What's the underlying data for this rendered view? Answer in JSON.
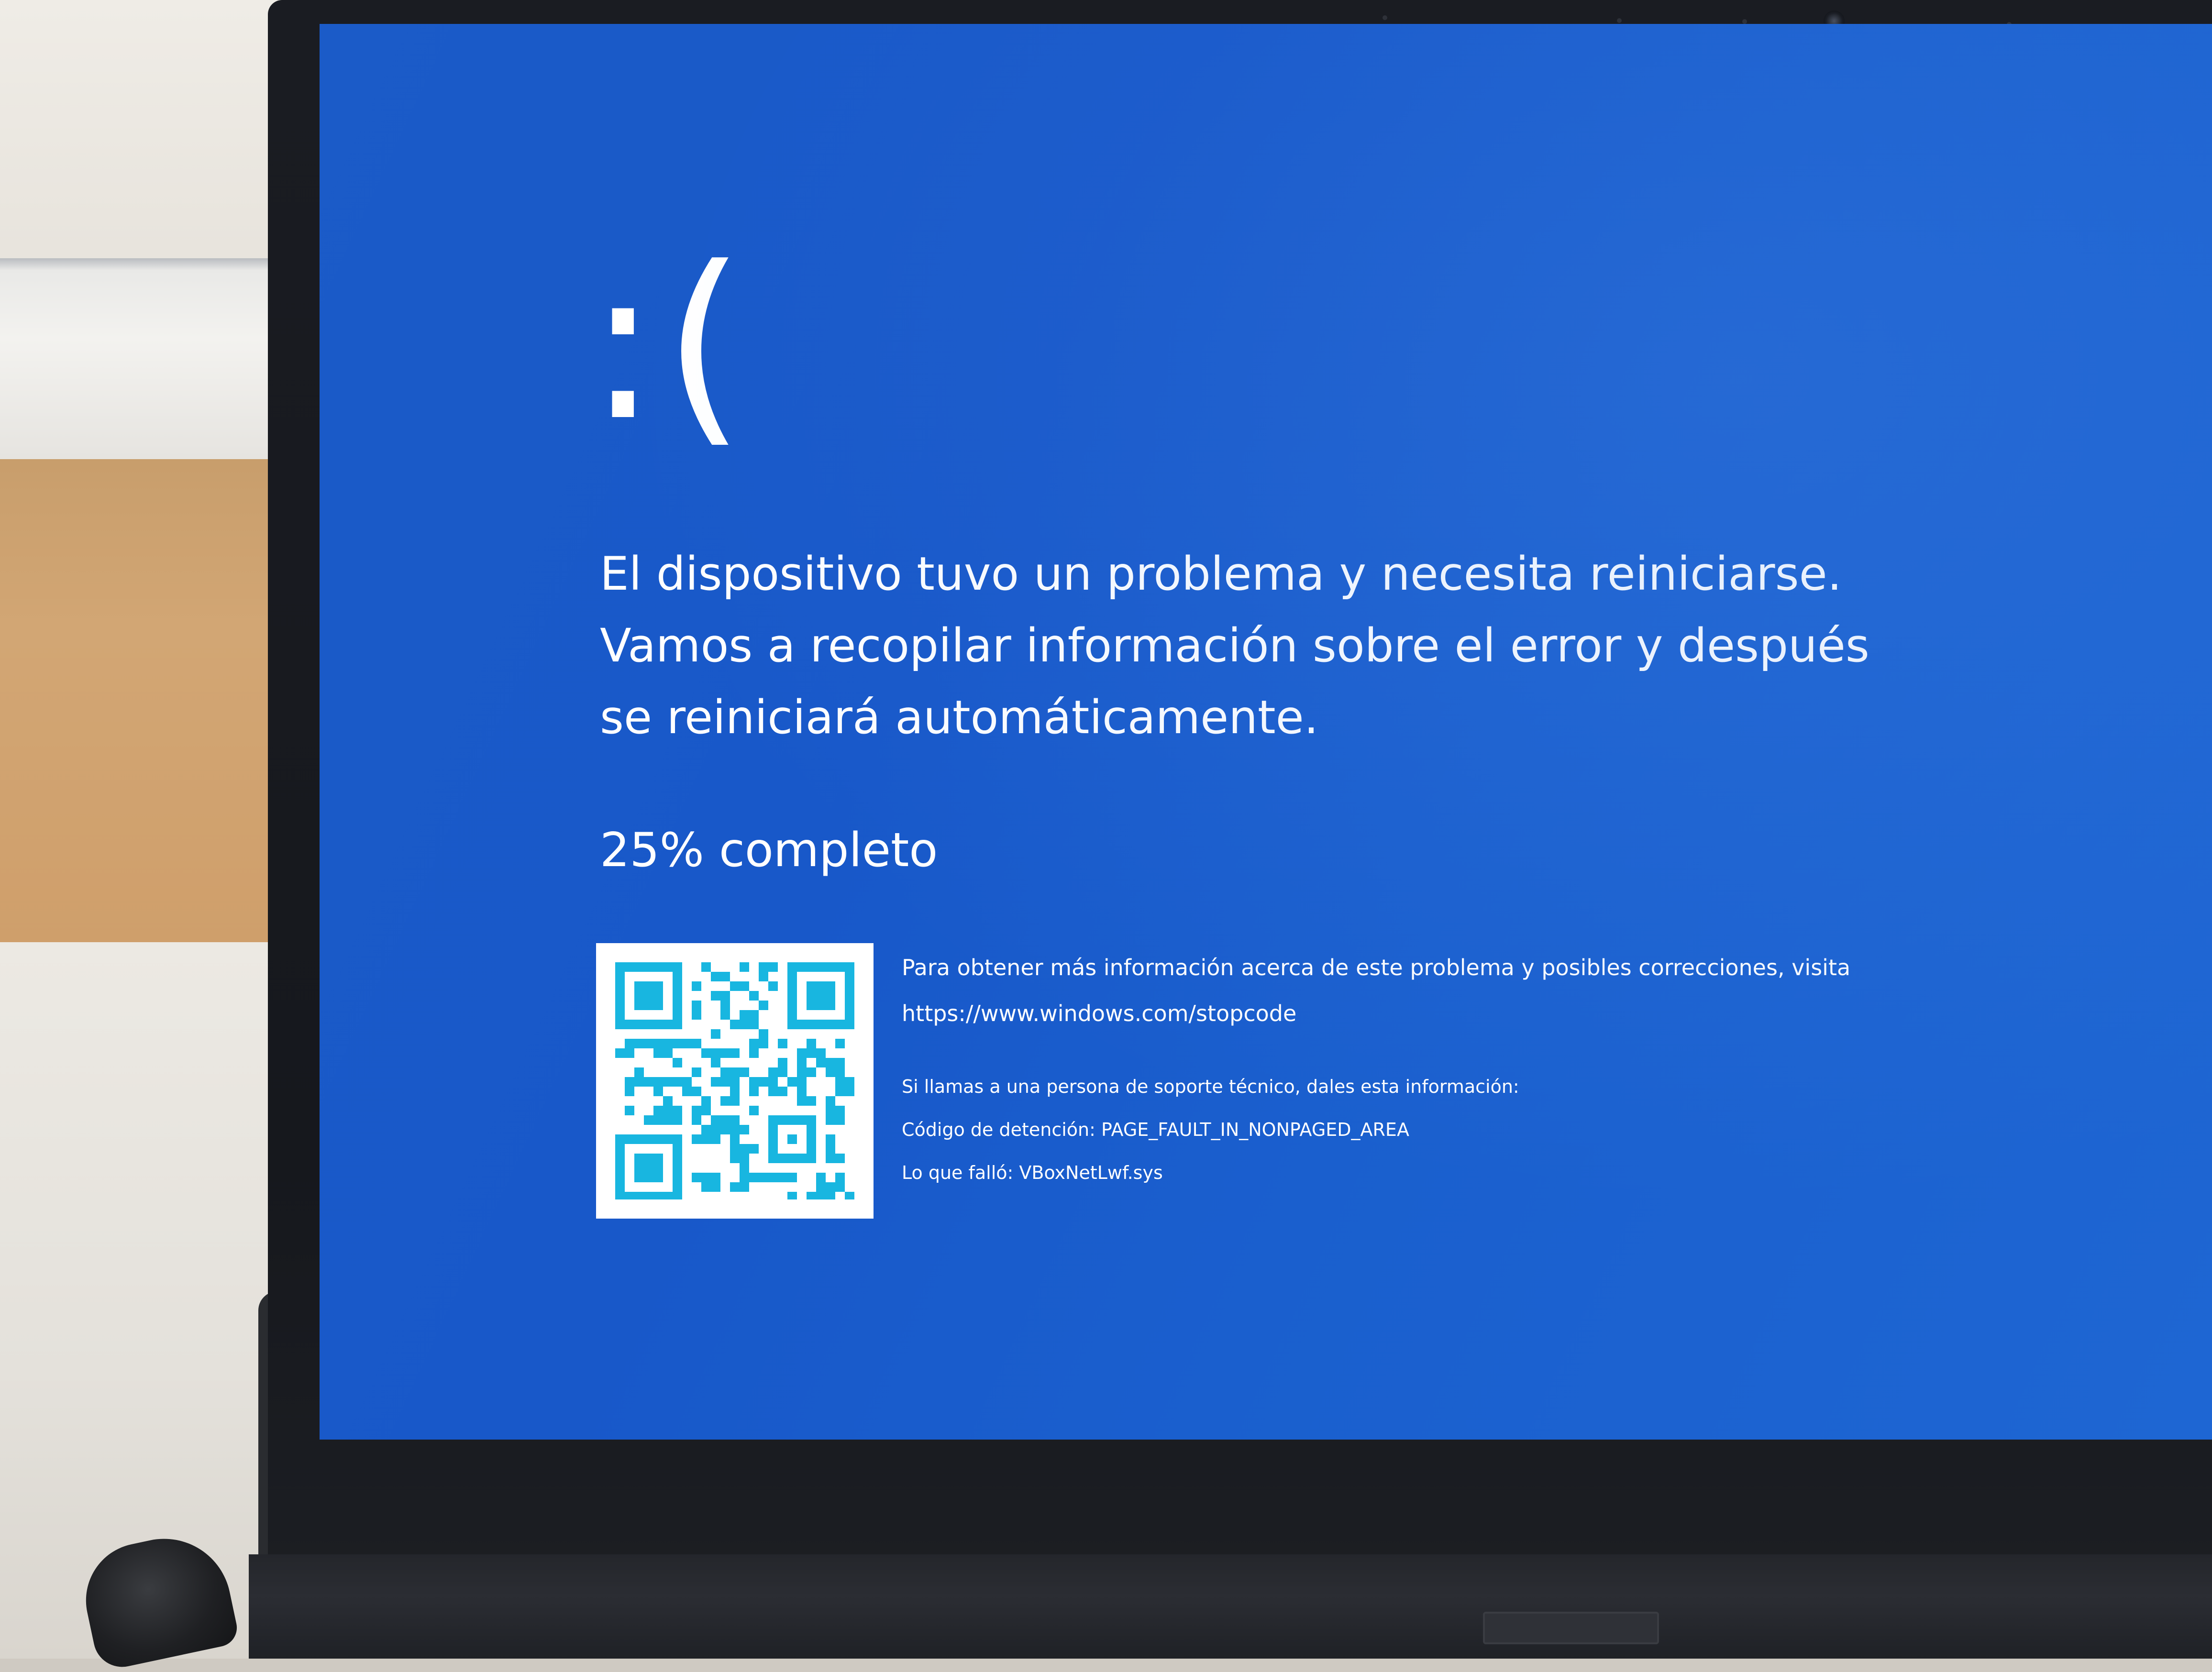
{
  "bsod": {
    "sad_face": ":(",
    "message_lines": [
      "El dispositivo tuvo un problema y necesita reiniciarse.",
      "Vamos a recopilar información sobre el error y después",
      "se reiniciará automáticamente."
    ],
    "progress_text": "25% completo",
    "progress_percent": 25,
    "more_info_text": "Para obtener más información acerca de este problema y posibles correcciones, visita",
    "stopcode_url": "https://www.windows.com/stopcode",
    "support_text": "Si llamas a una persona de soporte técnico, dales esta información:",
    "stop_code_line": "Código de detención: PAGE_FAULT_IN_NONPAGED_AREA",
    "failed_line": "Lo que falló: VBoxNetLwf.sys"
  },
  "colors": {
    "screen_blue": "#1a5bcb",
    "qr_cyan": "#18b6e0",
    "text": "#ffffff"
  }
}
